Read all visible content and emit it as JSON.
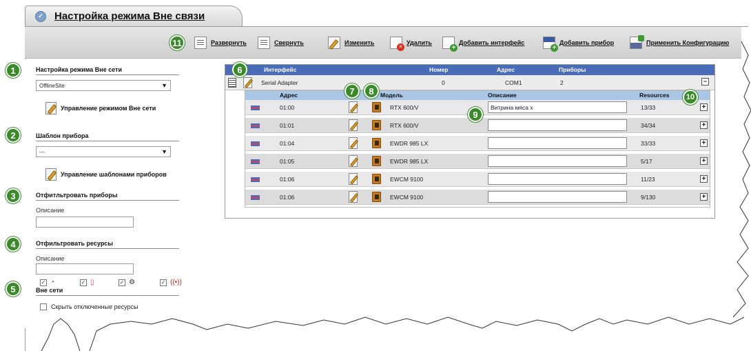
{
  "tab": {
    "title": "Настройка режима Вне связи"
  },
  "toolbar": {
    "expand": "Развернуть",
    "collapse": "Свернуть",
    "edit": "Изменить",
    "delete": "Удалить",
    "add_interface": "Добавить интерфейс",
    "add_device": "Добавить прибор",
    "apply_config": "Применить Конфигурацию"
  },
  "markers": [
    "1",
    "2",
    "3",
    "4",
    "5",
    "6",
    "7",
    "8",
    "9",
    "10",
    "11"
  ],
  "sidebar": {
    "offline_mode_title": "Настройка режима Вне сети",
    "offline_site_value": "OfflineSite",
    "manage_offline_label": "Управление режимом Вне сети",
    "device_template_title": "Шаблон прибора",
    "device_template_value": "---",
    "manage_templates_label": "Управление шаблонами приборов",
    "filter_devices_title": "Отфитльтровать приборы",
    "filter_devices_desc_label": "Описание",
    "filter_resources_title": "Отфильтровать ресурсы",
    "filter_resources_desc_label": "Описание",
    "offline_title": "Вне сети",
    "hide_disabled_label": "Скрыть отключенные ресурсы"
  },
  "interfaces_table": {
    "columns": {
      "interface": "Интерфейс",
      "number": "Номер",
      "address": "Адрес",
      "devices": "Приборы"
    },
    "row": {
      "interface": "Serial Adapter",
      "number": "0",
      "address": "COM1",
      "devices": "2"
    }
  },
  "devices_table": {
    "columns": {
      "address": "Адрес",
      "model": "Модель",
      "description": "Описание",
      "resources": "Resources"
    },
    "rows": [
      {
        "address": "01:00",
        "model": "RTX 600/V",
        "description": "Витрина мяса x",
        "resources": "13/33"
      },
      {
        "address": "01:01",
        "model": "RTX 600/V",
        "description": "",
        "resources": "34/34"
      },
      {
        "address": "01:04",
        "model": "EWDR 985 LX",
        "description": "",
        "resources": "33/33"
      },
      {
        "address": "01:05",
        "model": "EWDR 985 LX",
        "description": "",
        "resources": "5/17"
      },
      {
        "address": "01:06",
        "model": "EWCM 9100",
        "description": "",
        "resources": "11/23"
      },
      {
        "address": "01:06",
        "model": "EWCM 9100",
        "description": "",
        "resources": "9/130"
      }
    ]
  },
  "colors": {
    "accent": "#4a6cb8",
    "subheader": "#a9c6e6",
    "marker": "#3a8a2a"
  }
}
